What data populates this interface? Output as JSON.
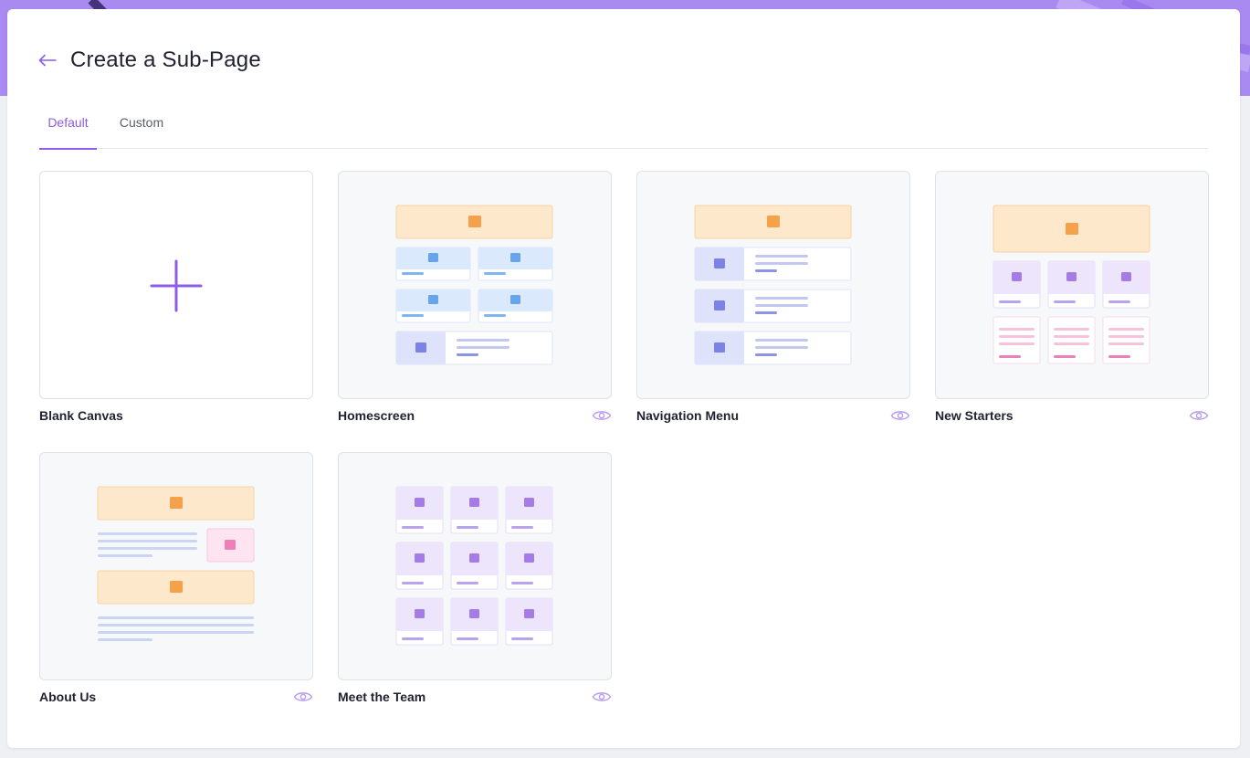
{
  "header": {
    "title": "Create a Sub-Page"
  },
  "tabs": [
    {
      "label": "Default",
      "active": true
    },
    {
      "label": "Custom",
      "active": false
    }
  ],
  "templates": [
    {
      "label": "Blank Canvas",
      "icon": "plus-icon",
      "preview": false
    },
    {
      "label": "Homescreen",
      "icon": "eye-icon",
      "preview": true
    },
    {
      "label": "Navigation Menu",
      "icon": "eye-icon",
      "preview": true
    },
    {
      "label": "New Starters",
      "icon": "eye-icon",
      "preview": true
    },
    {
      "label": "About Us",
      "icon": "eye-icon",
      "preview": true
    },
    {
      "label": "Meet the Team",
      "icon": "eye-icon",
      "preview": true
    }
  ],
  "colors": {
    "accent": "#8d5ce8",
    "band": "#a98af0",
    "orange": "#f5a04a",
    "blue": "#66a4ee",
    "indigo": "#7b83e6",
    "purple": "#a57ce6",
    "pink": "#ef7fb8"
  }
}
